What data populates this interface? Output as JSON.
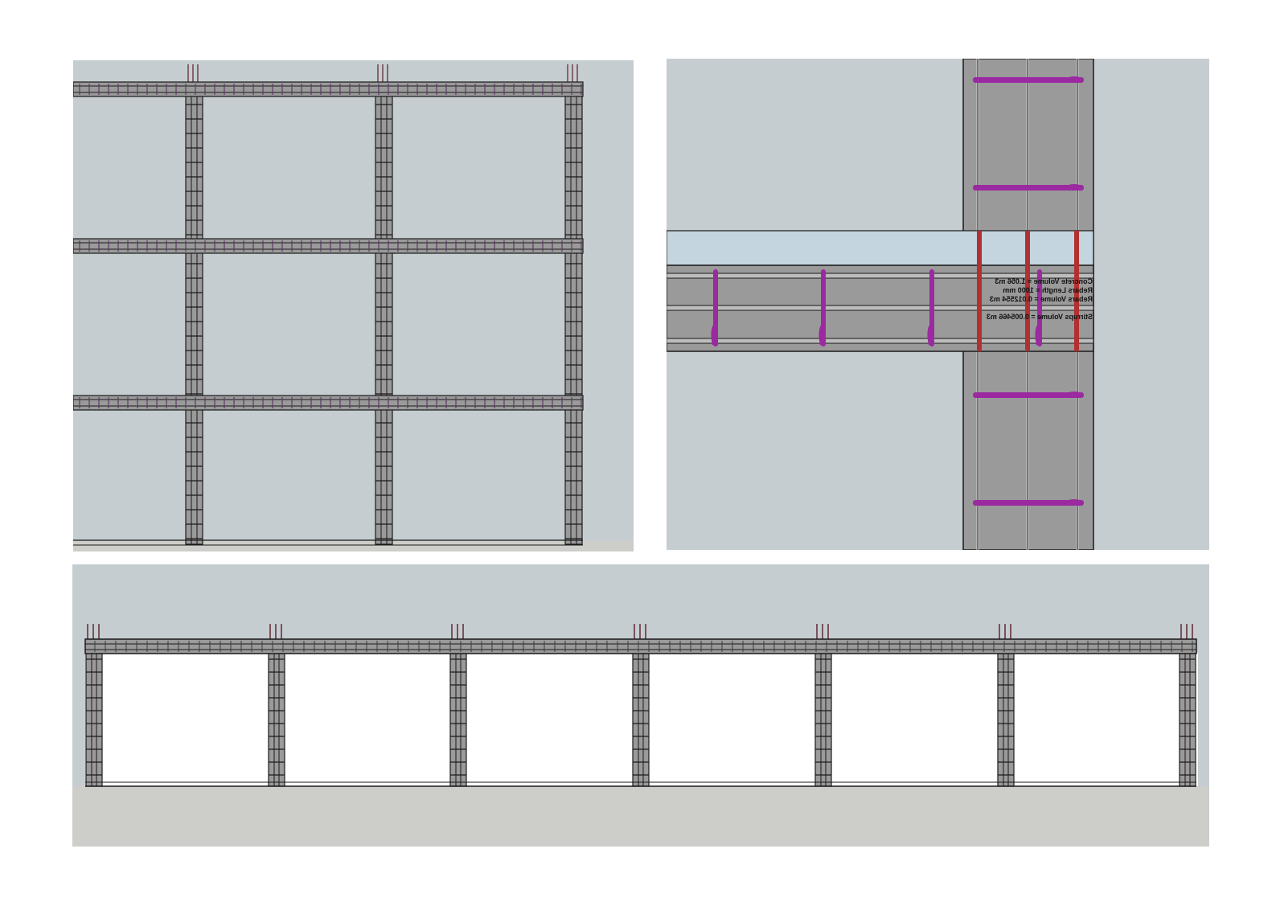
{
  "colors": {
    "viewport_background": "#c6cdd1",
    "white_space": "#ffffff",
    "ground": "#cdcec9",
    "concrete": "#9a9a9a",
    "concrete_light": "#bdbdbd",
    "outline": "#1a1a1a",
    "stirrup": "#9b2aa0",
    "longitudinal_bar": "#b23030",
    "beam_opening": "#c5d5df"
  },
  "viewports": {
    "frame": {
      "label": "frame-grid-view",
      "bays": 3,
      "storeys": 3
    },
    "detail": {
      "label": "beam-column-joint-detail",
      "annotation_lines": [
        "Concrete Volume = 1.056 m3",
        "Rebars Length = 1000 mm",
        "Rebars Volume = 0.012554 m3",
        "",
        "Stirrups Volume = 0.005466 m3"
      ]
    },
    "elevation": {
      "label": "building-elevation-view",
      "bays": 6
    }
  }
}
